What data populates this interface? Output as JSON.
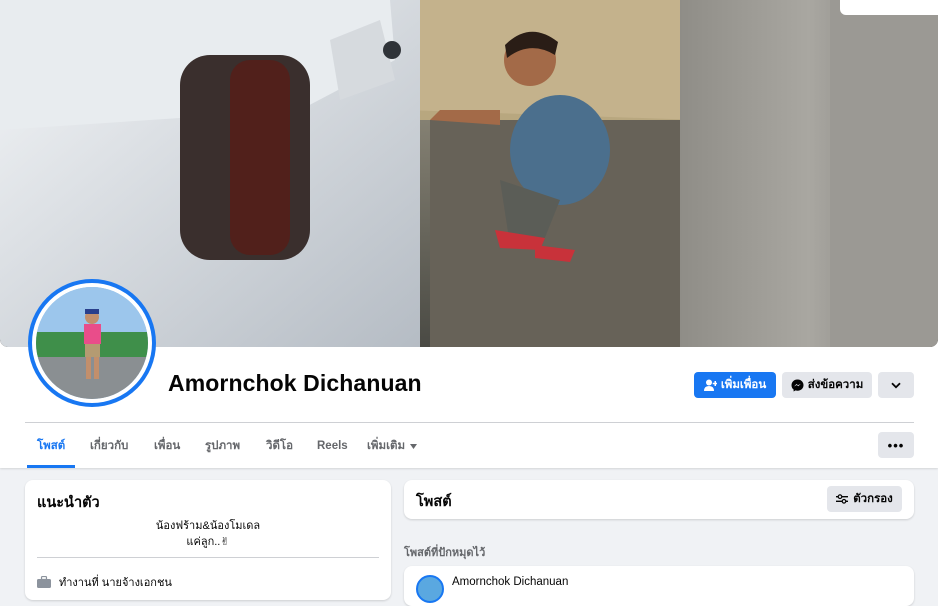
{
  "profile": {
    "name": "Amornchok Dichanuan",
    "bio_line1": "น้องฟร้าม&น้องโมเดล",
    "bio_line2": "แค่ลูก..✌"
  },
  "actions": {
    "add_friend_label": "เพิ่มเพื่อน",
    "message_label": "ส่งข้อความ",
    "more_icon": "chevron-down-icon"
  },
  "tabs": [
    {
      "label": "โพสต์",
      "active": true
    },
    {
      "label": "เกี่ยวกับ",
      "active": false
    },
    {
      "label": "เพื่อน",
      "active": false
    },
    {
      "label": "รูปภาพ",
      "active": false
    },
    {
      "label": "วิดีโอ",
      "active": false
    },
    {
      "label": "Reels",
      "active": false
    },
    {
      "label": "เพิ่มเติม",
      "active": false
    }
  ],
  "intro": {
    "title": "แนะนำตัว",
    "item_text": "ทำงานที่ นายจ้างเอกชน"
  },
  "posts": {
    "title": "โพสต์",
    "filter_label": "ตัวกรอง",
    "pinned_label": "โพสต์ที่ปักหมุดไว้",
    "pinned_author": "Amornchok Dichanuan"
  },
  "colors": {
    "accent": "#1877f2",
    "secondary_button": "#e4e6eb",
    "page_background": "#f0f2f5"
  }
}
